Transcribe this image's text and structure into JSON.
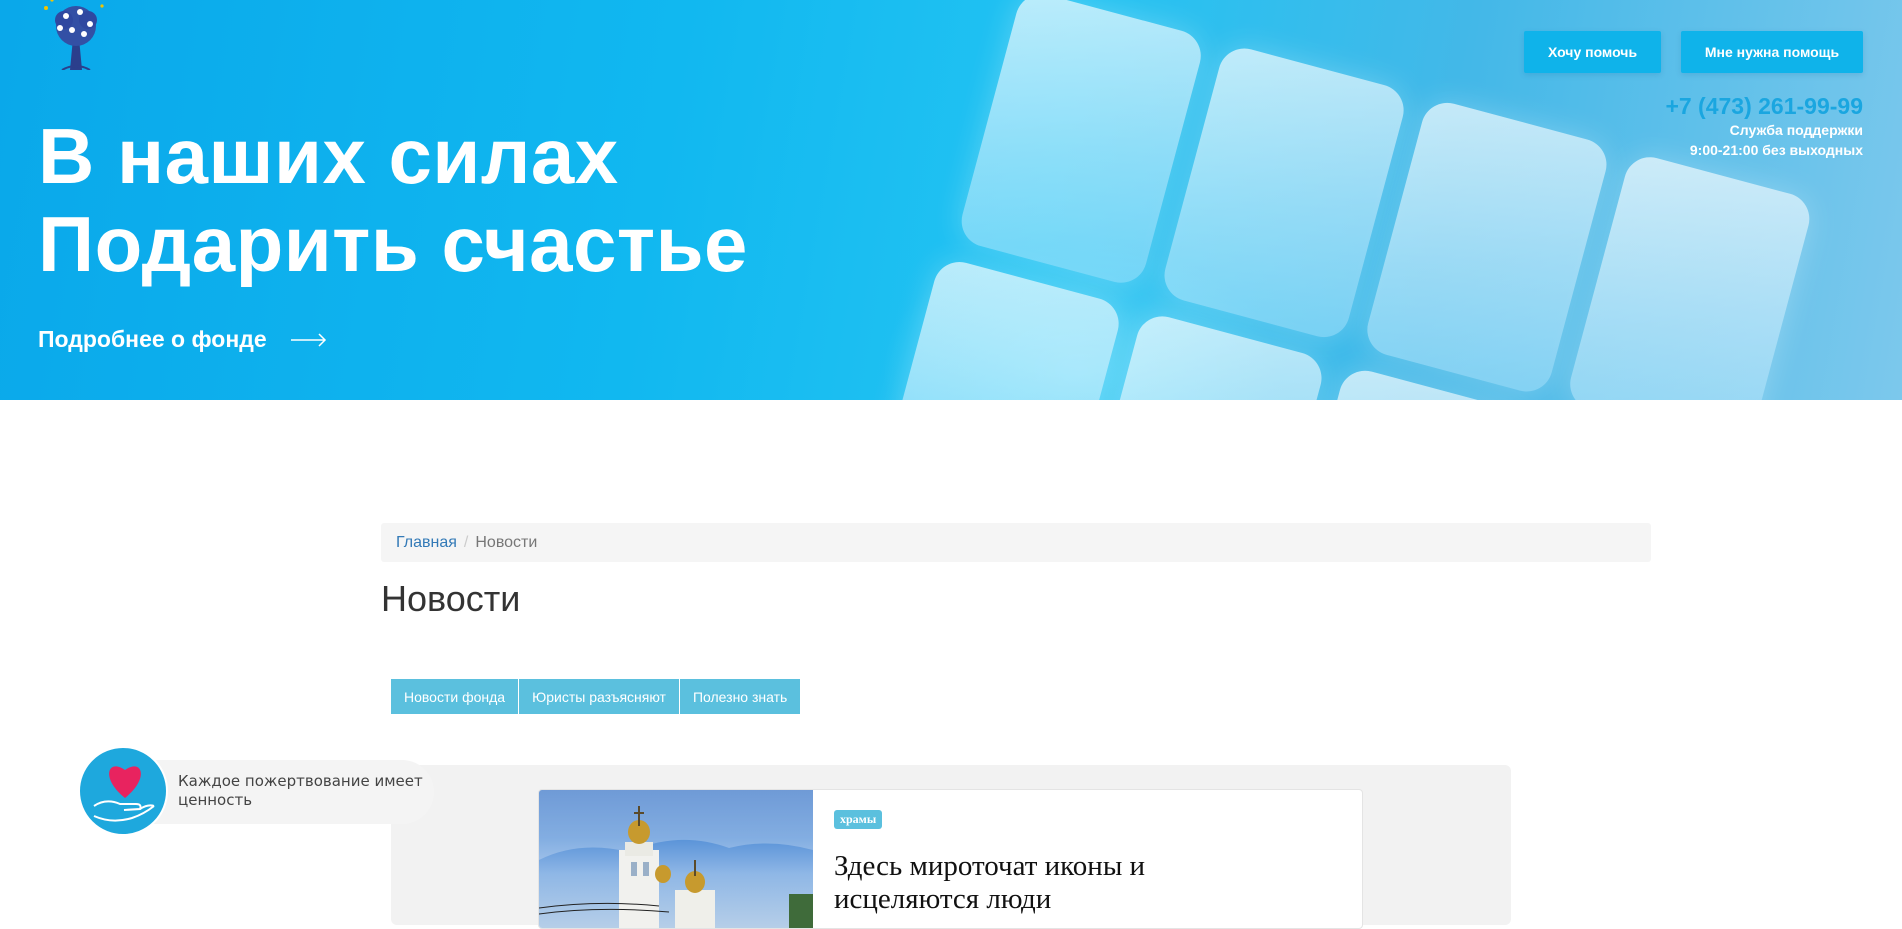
{
  "hero": {
    "title_line1": "В наших силах",
    "title_line2": "Подарить счастье",
    "more_link": "Подробнее о фонде",
    "btn_help": "Хочу помочь",
    "btn_need_help": "Мне нужна помощь",
    "phone": "+7 (473) 261-99-99",
    "support_label": "Служба поддержки",
    "hours": "9:00-21:00 без выходных"
  },
  "breadcrumb": {
    "home": "Главная",
    "separator": "/",
    "current": "Новости"
  },
  "page": {
    "title": "Новости"
  },
  "tabs": [
    {
      "label": "Новости фонда"
    },
    {
      "label": "Юристы разъясняют"
    },
    {
      "label": "Полезно знать"
    }
  ],
  "news": [
    {
      "tag": "храмы",
      "title": "Здесь мироточат иконы и исцеляются люди"
    }
  ],
  "donation_widget": {
    "text": "Каждое пожертвование имеет ценность"
  },
  "colors": {
    "accent": "#0fb3ea",
    "tab": "#5bc0de",
    "link": "#337ab7",
    "heart": "#e8235f"
  }
}
